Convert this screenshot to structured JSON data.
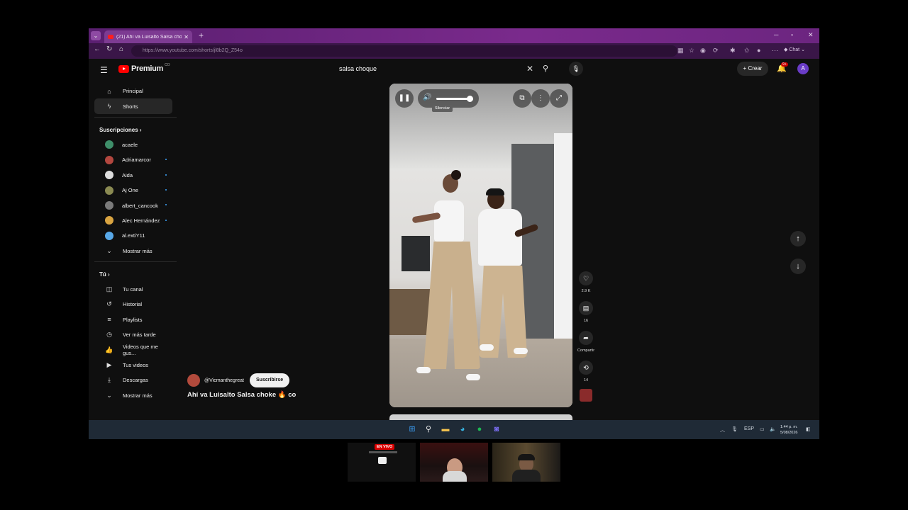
{
  "browser": {
    "tab_title": "(21) Ahí va Luisalto Salsa chok",
    "url": "https://www.youtube.com/shorts/jl8b2Q_Z54o",
    "copilot_label": "Chat"
  },
  "header": {
    "logo_text": "Premium",
    "logo_country": "CO",
    "search_value": "salsa choque",
    "create_label": "Crear",
    "notif_count": "9+",
    "avatar_letter": "A"
  },
  "sidebar": {
    "main": [
      {
        "label": "Principal",
        "icon": "home-icon"
      },
      {
        "label": "Shorts",
        "icon": "shorts-icon"
      }
    ],
    "subs_title": "Suscripciones",
    "subs": [
      {
        "label": "acaele",
        "color": "#3f8f6a",
        "dot": false
      },
      {
        "label": "Adriamarcor",
        "color": "#b3473f",
        "dot": true
      },
      {
        "label": "Aida",
        "color": "#dddddd",
        "dot": true
      },
      {
        "label": "Aj One",
        "color": "#8a8a52",
        "dot": true
      },
      {
        "label": "albert_cancook",
        "color": "#7a7a7a",
        "dot": true
      },
      {
        "label": "Alec Hernández",
        "color": "#d9a441",
        "dot": true
      },
      {
        "label": "al.extiY11",
        "color": "#58a8e8",
        "dot": false
      }
    ],
    "more_label": "Mostrar más",
    "you_title": "Tú",
    "you": [
      {
        "label": "Tu canal",
        "icon": "channel-icon"
      },
      {
        "label": "Historial",
        "icon": "history-icon"
      },
      {
        "label": "Playlists",
        "icon": "playlists-icon"
      },
      {
        "label": "Ver más tarde",
        "icon": "watch-later-icon"
      },
      {
        "label": "Videos que me gus...",
        "icon": "liked-icon"
      },
      {
        "label": "Tus videos",
        "icon": "your-videos-icon"
      },
      {
        "label": "Descargas",
        "icon": "downloads-icon"
      }
    ],
    "you_more_label": "Mostrar más"
  },
  "player": {
    "tooltip": "Silenciar",
    "volume_fraction": 0.9
  },
  "short": {
    "channel": "@Vicmanthegreat",
    "subscribe_label": "Suscribirse",
    "title": "Ahí va Luisalto Salsa choke 🔥 co"
  },
  "actions": {
    "likes": "2.9 K",
    "comments": "16",
    "share_label": "Compartir",
    "remix": "14"
  },
  "taskbar": {
    "lang": "ESP",
    "time": "1:44 p. m.",
    "date": "5/08/2026"
  },
  "overlay": {
    "live_label": "EN VIVO"
  }
}
